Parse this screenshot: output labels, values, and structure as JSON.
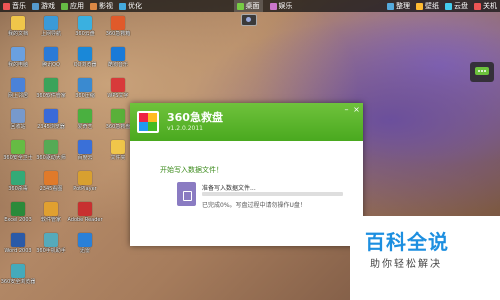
{
  "topbar": {
    "left": [
      {
        "label": "音乐",
        "icon": "music-icon",
        "color": "#e55"
      },
      {
        "label": "游戏",
        "icon": "game-icon",
        "color": "#59c"
      },
      {
        "label": "应用",
        "icon": "app-icon",
        "color": "#6b4"
      },
      {
        "label": "影视",
        "icon": "video-icon",
        "color": "#d84"
      },
      {
        "label": "优化",
        "icon": "optimize-icon",
        "color": "#4ad"
      }
    ],
    "middle": [
      {
        "label": "桌面",
        "icon": "desktop-icon",
        "color": "#7c4"
      },
      {
        "label": "娱乐",
        "icon": "entertainment-icon",
        "color": "#c7c"
      }
    ],
    "right": [
      {
        "label": "整理",
        "icon": "organize-icon",
        "color": "#5ad"
      },
      {
        "label": "壁纸",
        "icon": "wallpaper-icon",
        "color": "#fb3"
      },
      {
        "label": "云盘",
        "icon": "cloud-icon",
        "color": "#4ce"
      },
      {
        "label": "关机",
        "icon": "power-icon",
        "color": "#e55"
      }
    ]
  },
  "desktop": {
    "col1": [
      {
        "label": "我的文档",
        "color": "#f0c64a"
      },
      {
        "label": "我的电脑",
        "color": "#6aa0e0"
      },
      {
        "label": "网上邻居",
        "color": "#4b82d8"
      },
      {
        "label": "回收站",
        "color": "#79c"
      },
      {
        "label": "360安全卫士",
        "color": "#6b4"
      },
      {
        "label": "360杀毒",
        "color": "#3a7"
      },
      {
        "label": "Excel 2003",
        "color": "#2a8a3a"
      },
      {
        "label": "Word 2003",
        "color": "#2a5aa8"
      },
      {
        "label": "360安全浏览器",
        "color": "#4ab"
      }
    ],
    "col2": [
      {
        "label": "上网导航",
        "color": "#3a9ad8"
      },
      {
        "label": "腾讯QQ",
        "color": "#2a7ad8"
      },
      {
        "label": "360软件管家",
        "color": "#3aa35a"
      },
      {
        "label": "2345浏览器",
        "color": "#3a6ad8"
      },
      {
        "label": "360驱动大师",
        "color": "#5a5"
      },
      {
        "label": "2345看图",
        "color": "#e07a2a"
      },
      {
        "label": "软件管家",
        "color": "#e0a030"
      },
      {
        "label": "360手机助手",
        "color": "#5ab"
      }
    ],
    "col3": [
      {
        "label": "360云盘",
        "color": "#3ab0e0"
      },
      {
        "label": "QQ浏览器",
        "color": "#1a88d8"
      },
      {
        "label": "360压缩",
        "color": "#3a8ad0"
      },
      {
        "label": "爱奇艺",
        "color": "#4ab040"
      },
      {
        "label": "百度云",
        "color": "#3a70d8"
      },
      {
        "label": "PotPlayer",
        "color": "#d8a030"
      },
      {
        "label": "Adobe Reader",
        "color": "#c83030"
      },
      {
        "label": "迅雷",
        "color": "#2a80d8"
      }
    ],
    "col4": [
      {
        "label": "360急救箱",
        "color": "#e05a2a"
      },
      {
        "label": "酷狗音乐",
        "color": "#1a7ad8"
      },
      {
        "label": "WPS文字",
        "color": "#d83a3a"
      },
      {
        "label": "360急救盘",
        "color": "#5ab03a"
      },
      {
        "label": "文件夹",
        "color": "#f0c64a"
      }
    ]
  },
  "dialog": {
    "title": "360急救盘",
    "version": "v1.2.0.2011",
    "stage": "开始写入数据文件！",
    "preparing": "准备写入数据文件...",
    "done_text": "已完成0%。写盘过程中请勿操作U盘！",
    "progress_pct": 0,
    "accent": "#4aa91f"
  },
  "watermark": {
    "title": "百科全说",
    "subtitle": "助你轻松解决"
  }
}
